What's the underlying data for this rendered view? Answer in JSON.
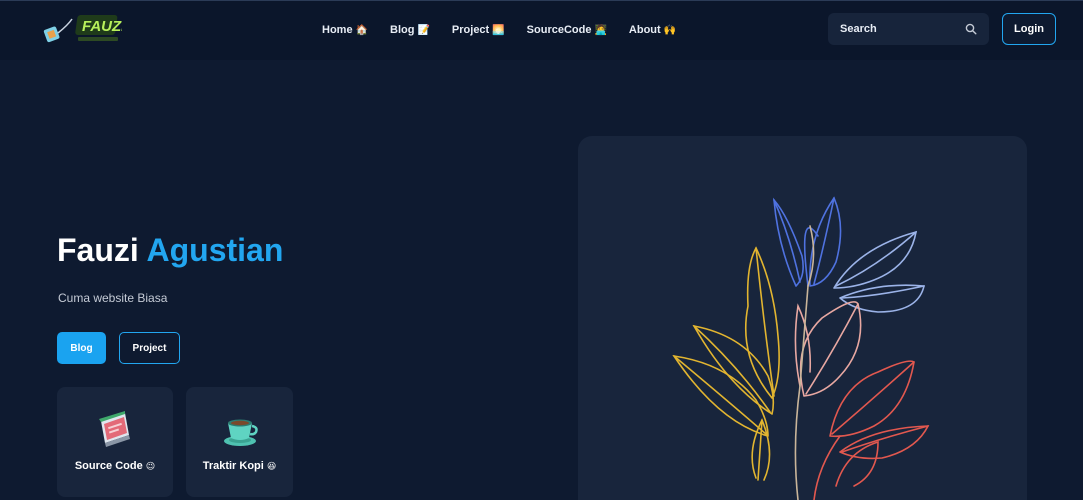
{
  "brand": {
    "logo_text": "FAUZI"
  },
  "nav": [
    {
      "label": "Home",
      "emoji": "🏠"
    },
    {
      "label": "Blog",
      "emoji": "📝"
    },
    {
      "label": "Project",
      "emoji": "🌅"
    },
    {
      "label": "SourceCode",
      "emoji": "🧑‍💻"
    },
    {
      "label": "About",
      "emoji": "🙌"
    }
  ],
  "search": {
    "placeholder": "Search"
  },
  "login_label": "Login",
  "hero": {
    "title_first": "Fauzi",
    "title_accent": "Agustian",
    "subtitle": "Cuma website Biasa",
    "btn_blog": "Blog",
    "btn_project": "Project"
  },
  "cards": [
    {
      "label": "Source Code",
      "emoji": "😉",
      "icon": "code-window-icon"
    },
    {
      "label": "Traktir Kopi",
      "emoji": "😆",
      "icon": "coffee-cup-icon"
    }
  ],
  "colors": {
    "background": "#0e1a30",
    "header": "#0b162b",
    "accent": "#22a6f0",
    "card": "#18253c",
    "leaf_yellow": "#e2b530",
    "leaf_blue": "#4f72e0",
    "leaf_lightblue": "#9bb3e8",
    "leaf_pink": "#e8a8a2",
    "leaf_red": "#e2584f"
  }
}
